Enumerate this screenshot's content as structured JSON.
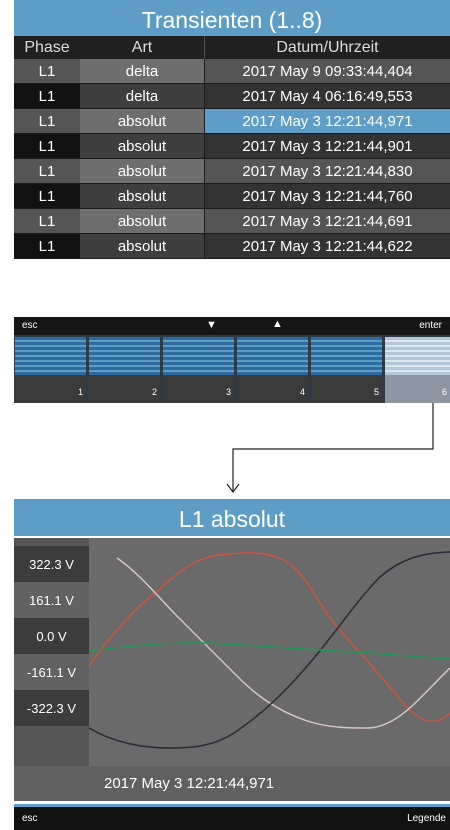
{
  "list_screen": {
    "title": "Transienten (1..8)",
    "columns": [
      "Phase",
      "Art",
      "Datum/Uhrzeit"
    ],
    "rows": [
      {
        "phase": "L1",
        "art": "delta",
        "datetime": "2017 May  9 09:33:44,404"
      },
      {
        "phase": "L1",
        "art": "delta",
        "datetime": "2017 May  4 06:16:49,553"
      },
      {
        "phase": "L1",
        "art": "absolut",
        "datetime": "2017 May  3 12:21:44,971"
      },
      {
        "phase": "L1",
        "art": "absolut",
        "datetime": "2017 May  3 12:21:44,901"
      },
      {
        "phase": "L1",
        "art": "absolut",
        "datetime": "2017 May  3 12:21:44,830"
      },
      {
        "phase": "L1",
        "art": "absolut",
        "datetime": "2017 May  3 12:21:44,760"
      },
      {
        "phase": "L1",
        "art": "absolut",
        "datetime": "2017 May  3 12:21:44,691"
      },
      {
        "phase": "L1",
        "art": "absolut",
        "datetime": "2017 May  3 12:21:44,622"
      }
    ],
    "selected_row": 3,
    "softkeys": {
      "esc": "esc",
      "down": "▼",
      "up": "▲",
      "enter": "enter"
    },
    "key_numbers": [
      "1",
      "2",
      "3",
      "4",
      "5",
      "6"
    ]
  },
  "detail_screen": {
    "title": "L1 absolut",
    "y_labels": [
      "322.3 V",
      "161.1 V",
      "0.0 V",
      "-161.1 V",
      "-322.3 V"
    ],
    "timestamp": "2017 May  3 12:21:44,971",
    "softkeys": {
      "esc": "esc",
      "legend": "Legende"
    },
    "colors": {
      "accent": "#5d9dc6",
      "phase_red": "#d2553a",
      "phase_black": "#2a2a36",
      "phase_white": "#d8c8c8",
      "phase_green": "#1f9a55"
    }
  }
}
